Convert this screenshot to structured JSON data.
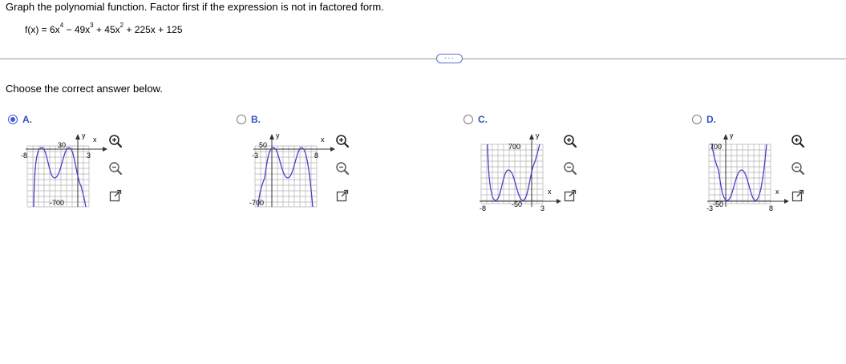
{
  "question": "Graph the polynomial function. Factor first if the expression is not in factored form.",
  "formula": {
    "lhs": "f(x) = 6x",
    "exp1": "4",
    "t2": " − 49x",
    "exp2": "3",
    "t3": " + 45x",
    "exp3": "2",
    "t4": " + 225x + 125"
  },
  "more_label": "···",
  "prompt": "Choose the correct answer below.",
  "selected": "A",
  "colors": {
    "curve": "#4a3fc7",
    "accent": "#3b5bdb",
    "grid": "#9a9a9a"
  },
  "options": [
    {
      "letter": "A.",
      "top_label": "30",
      "bottom_label": "-700",
      "left_label": "-8",
      "right_label": "3",
      "x_label": "x",
      "y_label": "y"
    },
    {
      "letter": "B.",
      "top_label": "50",
      "bottom_label": "-700",
      "left_label": "-3",
      "right_label": "8",
      "x_label": "x",
      "y_label": "y"
    },
    {
      "letter": "C.",
      "top_label": "700",
      "bottom_label": "-50",
      "left_label": "-8",
      "right_label": "3",
      "x_label": "x",
      "y_label": "y"
    },
    {
      "letter": "D.",
      "top_label": "700",
      "bottom_label": "-50",
      "left_label": "-3",
      "right_label": "8",
      "x_label": "x",
      "y_label": "y"
    }
  ],
  "tools": {
    "zoom_in": "zoom-in-icon",
    "zoom_out": "zoom-out-icon",
    "popout": "popout-icon"
  }
}
